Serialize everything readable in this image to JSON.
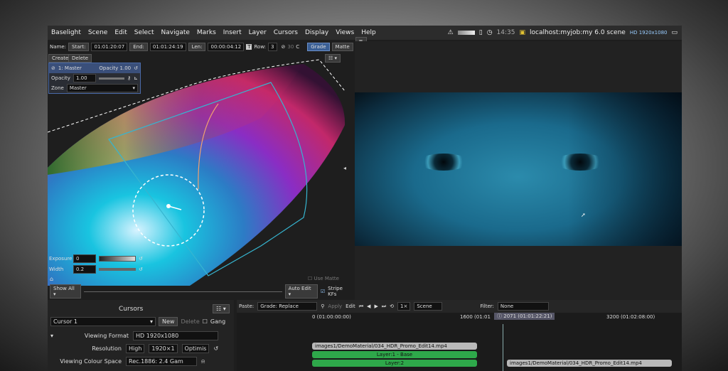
{
  "menu": [
    "Baselight",
    "Scene",
    "Edit",
    "Select",
    "Navigate",
    "Marks",
    "Insert",
    "Layer",
    "Cursors",
    "Display",
    "Views",
    "Help"
  ],
  "status": {
    "time": "14:35",
    "job": "localhost:myjob:my 6.0 scene",
    "format": "HD 1920x1080"
  },
  "toolbar": {
    "name_label": "Name:",
    "start_label": "Start:",
    "start": "01:01:20:07",
    "end_label": "End:",
    "end": "01:01:24:19",
    "len_label": "Len:",
    "len": "00:00:04:12",
    "row_label": "Row:",
    "row": "3",
    "num30": "30",
    "c": "C",
    "grade": "Grade",
    "matte": "Matte",
    "list": "1"
  },
  "buttons": {
    "create": "Create",
    "delete": "Delete"
  },
  "layer": {
    "title": "1: Master",
    "opacity_label": "Opacity",
    "opacity_value": "1.00",
    "opacity_header": "Opacity 1.00",
    "zone_label": "Zone",
    "zone": "Master"
  },
  "controls": {
    "exposure_label": "Exposure",
    "exposure": "0",
    "width_label": "Width",
    "width": "0.2",
    "use_matte": "Use Matte"
  },
  "bottombar": {
    "show_all": "Show All",
    "auto_edit": "Auto Edit",
    "stripe": "Stripe KFs"
  },
  "cursors": {
    "title": "Cursors",
    "cursor": "Cursor 1",
    "new": "New",
    "delete": "Delete",
    "gang": "Gang",
    "vf_label": "Viewing Format",
    "vf": "HD 1920x1080",
    "res_label": "Resolution",
    "res_a": "High",
    "res_b": "1920×1",
    "res_c": "Optimis",
    "vcs_label": "Viewing Colour Space",
    "vcs": "Rec.1886: 2.4 Gam"
  },
  "timeline": {
    "paste_label": "Paste:",
    "paste": "Grade: Replace",
    "apply": "Apply",
    "edit": "Edit",
    "speed": "1×",
    "mode": "Scene",
    "filter_label": "Filter:",
    "filter": "None",
    "t0": "0 (01:00:00:00)",
    "t1": "1600 (01:01",
    "t2": "2071 (01:01:22:21)",
    "t3": "3200 (01:02:08:00)",
    "clip1": "images1/DemoMaterial/034_HDR_Promo_Edit14.mp4",
    "layer1": "Layer:1 - Base",
    "layer2": "Layer:2",
    "clip2": "images1/DemoMaterial/034_HDR_Promo_Edit14.mp4"
  },
  "colors": {
    "accent": "#3a5f95",
    "green": "#2ed12e",
    "strip_green": "#2ea84a"
  }
}
